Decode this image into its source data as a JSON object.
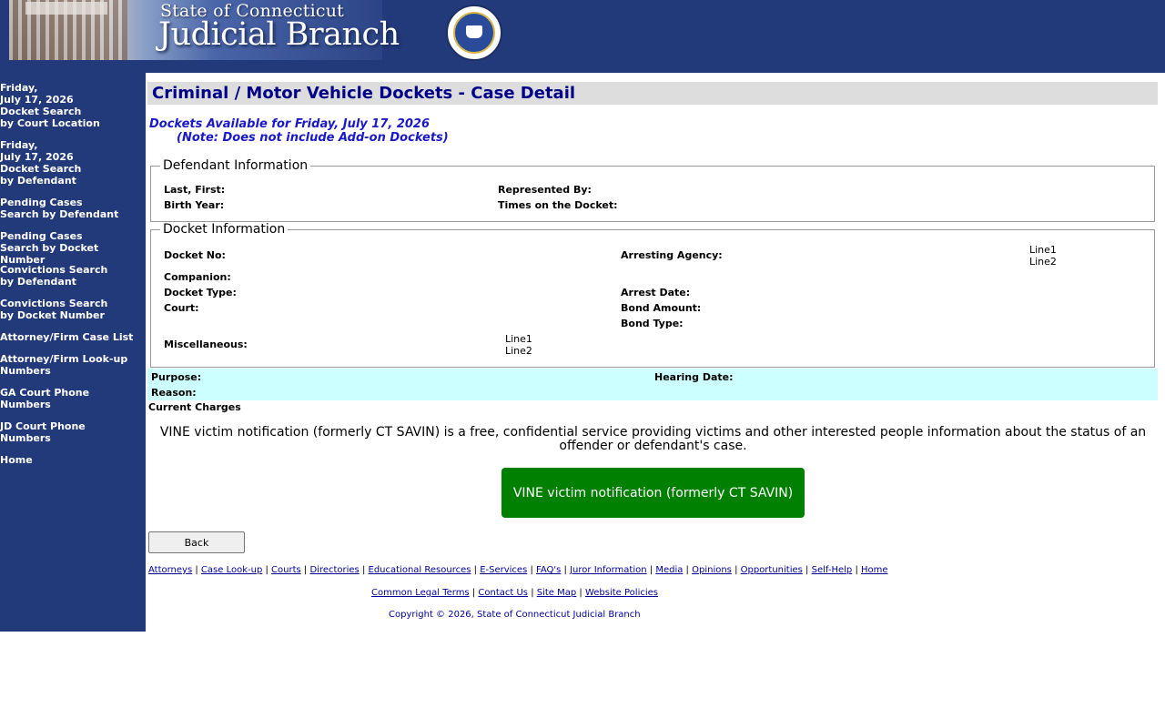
{
  "banner": {
    "subtitle": "State of Connecticut",
    "title": "Judicial Branch"
  },
  "sidebar": {
    "items": [
      {
        "label": "Friday,\nJuly 17, 2026\nDocket Search\nby Court Location"
      },
      {
        "label": "Friday,\nJuly 17, 2026\nDocket Search\nby Defendant"
      },
      {
        "label": "Pending Cases\nSearch by Defendant"
      },
      {
        "label": "Pending Cases\nSearch by Docket Number"
      },
      {
        "label": "Convictions Search\nby Defendant"
      },
      {
        "label": "Convictions Search\nby Docket Number"
      },
      {
        "label": "Attorney/Firm Case List"
      },
      {
        "label": "Attorney/Firm Look-up\nNumbers"
      },
      {
        "label": "GA Court Phone\nNumbers"
      },
      {
        "label": "JD Court Phone\nNumbers"
      },
      {
        "label": "Home"
      }
    ]
  },
  "main": {
    "title": "Criminal / Motor Vehicle Dockets - Case Detail",
    "available": "Dockets Available for Friday, July 17, 2026",
    "note": "(Note: Does not include Add-on Dockets)",
    "defendant": {
      "legend": "Defendant Information",
      "last_first": "Last, First:",
      "birth_year": "Birth Year:",
      "represented_by": "Represented By:",
      "times_on_docket": "Times on the Docket:"
    },
    "docket": {
      "legend": "Docket Information",
      "docket_no": "Docket No:",
      "arresting_agency": "Arresting Agency:",
      "agency_line1": "Line1",
      "agency_line2": "Line2",
      "companion": "Companion:",
      "docket_type": "Docket Type:",
      "arrest_date": "Arrest Date:",
      "court": "Court:",
      "bond_amount": "Bond Amount:",
      "bond_type": "Bond Type:",
      "miscellaneous": "Miscellaneous:",
      "misc_line1": "Line1",
      "misc_line2": "Line2"
    },
    "hearing": {
      "purpose": "Purpose:",
      "hearing_date": "Hearing Date:",
      "reason": "Reason:"
    },
    "current_charges": "Current Charges",
    "vine_text": "VINE victim notification (formerly CT SAVIN) is a free, confidential service providing victims and other interested people information about the status of an offender or defendant's case.",
    "vine_button": "VINE victim notification (formerly CT SAVIN)",
    "back_button": "Back"
  },
  "footer": {
    "links1": [
      "Attorneys",
      "Case Look-up",
      "Courts",
      "Directories",
      "Educational Resources",
      "E-Services",
      "FAQ's",
      "Juror Information",
      "Media",
      "Opinions",
      "Opportunities",
      "Self-Help",
      "Home"
    ],
    "links2": [
      "Common Legal Terms",
      "Contact Us",
      "Site Map",
      "Website Policies"
    ],
    "copyright": "Copyright © 2026, State of Connecticut Judicial Branch"
  }
}
